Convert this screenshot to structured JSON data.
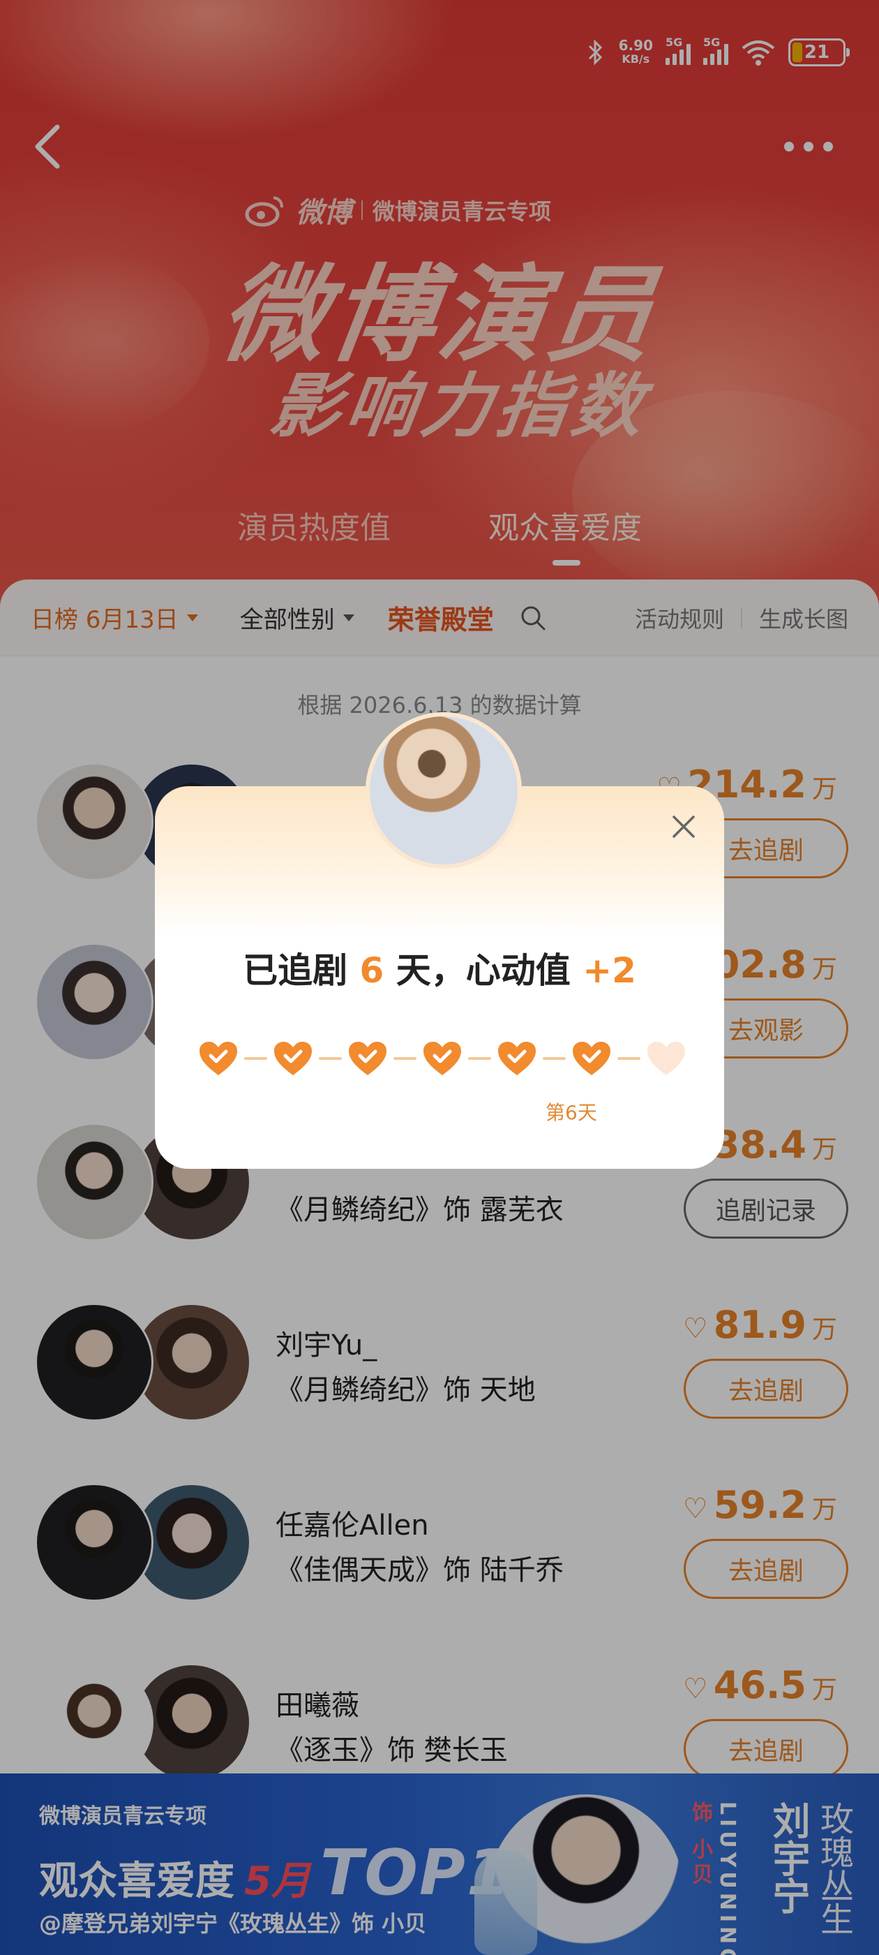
{
  "status_bar": {
    "speed": "6.90",
    "speed_unit": "KB/s",
    "sig1": "5G",
    "sig2": "5G",
    "battery": "21"
  },
  "header": {
    "brand": "微博",
    "brand_sub": "微博演员青云专项",
    "title": "微博演员",
    "subtitle": "影响力指数",
    "tabs": [
      {
        "label": "演员热度值"
      },
      {
        "label": "观众喜爱度"
      }
    ]
  },
  "filters": {
    "date": "日榜 6月13日",
    "gender": "全部性别",
    "honor": "荣誉殿堂",
    "rules": "活动规则",
    "long_image": "生成长图"
  },
  "calc_note": "根据 2026.6.13 的数据计算",
  "list": [
    {
      "name": "",
      "role": "",
      "score": "214.2",
      "unit": "万",
      "button": "去追剧"
    },
    {
      "name": "",
      "role": "",
      "score": "202.8",
      "unit": "万",
      "button": "去观影"
    },
    {
      "name": "",
      "role": "《月鳞绮纪》饰 露芜衣",
      "score": "138.4",
      "unit": "万",
      "button": "追剧记录"
    },
    {
      "name": "刘宇Yu_",
      "role": "《月鳞绮纪》饰 天地",
      "score": "81.9",
      "unit": "万",
      "button": "去追剧"
    },
    {
      "name": "任嘉伦Allen",
      "role": "《佳偶天成》饰 陆千乔",
      "score": "59.2",
      "unit": "万",
      "button": "去追剧"
    },
    {
      "name": "田曦薇",
      "role": "《逐玉》饰 樊长玉",
      "score": "46.5",
      "unit": "万",
      "button": "去追剧"
    }
  ],
  "popup": {
    "title_prefix": "已追剧",
    "days": "6",
    "title_mid": "天，心动值",
    "bonus": "+2",
    "day_label": "第6天",
    "streak_total": 7,
    "streak_done": 6
  },
  "banner": {
    "line1": "微博演员青云专项",
    "line2_a": "观众喜爱度",
    "line2_month": "5月",
    "line2_top": "TOP1",
    "line3": "@摩登兄弟刘宇宁《玫瑰丛生》饰 小贝",
    "v_pinyin": "LIUYUNING",
    "v_name": "刘宇宁",
    "v_role": "饰 小贝",
    "v_drama": "玫瑰丛生"
  },
  "colors": {
    "accent": "#e8822a",
    "header_red": "#e13a36",
    "banner_blue": "#2a63cf"
  }
}
